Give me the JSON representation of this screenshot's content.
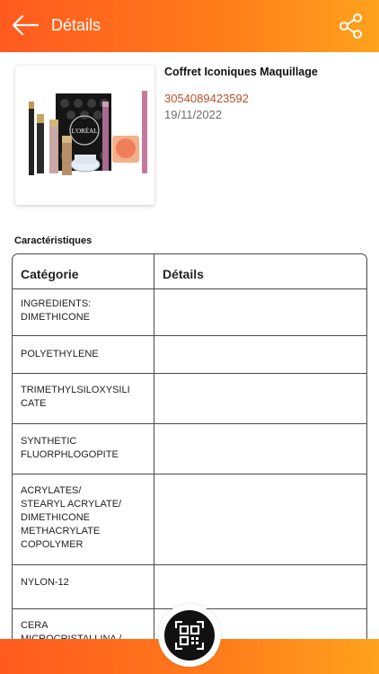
{
  "header": {
    "title": "Détails",
    "back_icon": "arrow-left-icon",
    "share_icon": "share-icon",
    "colors": {
      "start": "#ff5a1f",
      "end": "#ffa21d"
    }
  },
  "product": {
    "name": "Coffret Iconiques Maquillage",
    "code": "3054089423592",
    "date": "19/11/2022",
    "image_label": "L'ORÉAL",
    "code_color": "#b6502a"
  },
  "section": {
    "title": "Caractéristiques"
  },
  "table": {
    "headers": [
      "Catégorie",
      "Détails"
    ],
    "rows": [
      {
        "category": "INGREDIENTS:\nDIMETHICONE",
        "details": ""
      },
      {
        "category": " POLYETHYLENE",
        "details": ""
      },
      {
        "category": " TRIMETHYLSILOXYSILI\nCATE",
        "details": ""
      },
      {
        "category": " SYNTHETIC\nFLUORPHLOGOPITE",
        "details": ""
      },
      {
        "category": " ACRYLATES/\nSTEARYL ACRYLATE/\nDIMETHICONE\nMETHACRYLATE\nCOPOLYMER",
        "details": ""
      },
      {
        "category": " NYLON-12",
        "details": ""
      },
      {
        "category": " CERA\nMICROCRISTALLINA /",
        "details": ""
      }
    ]
  },
  "bottom": {
    "scan_icon": "qr-scan-icon"
  }
}
